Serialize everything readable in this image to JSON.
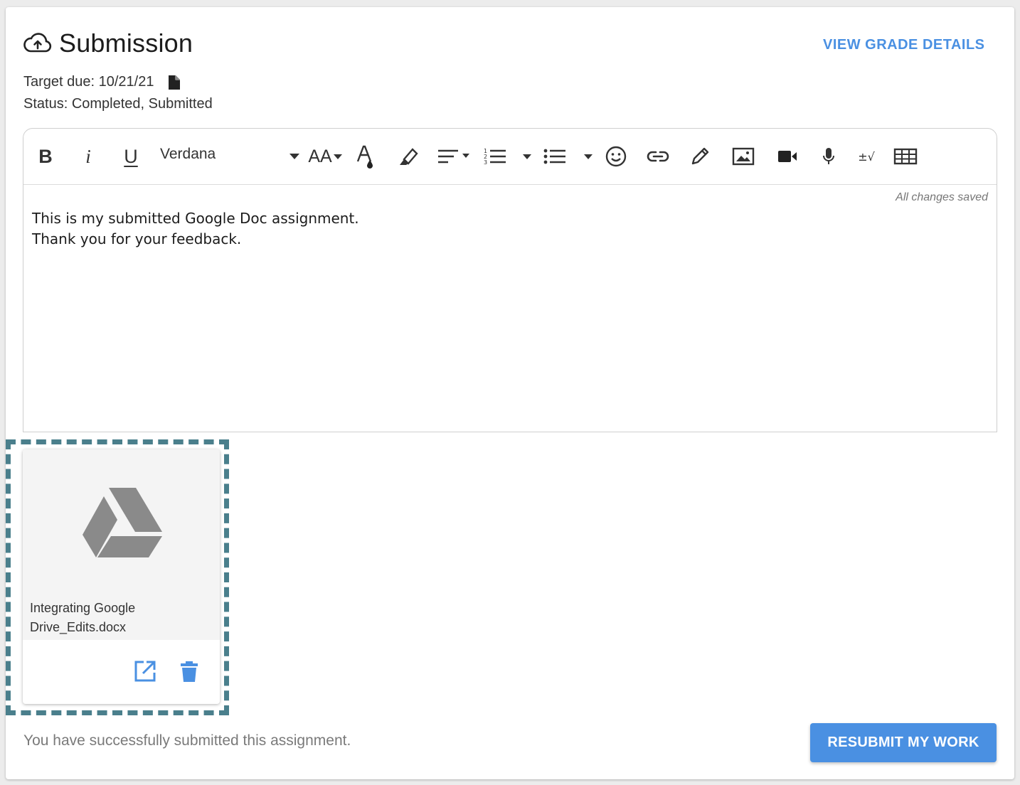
{
  "header": {
    "title": "Submission",
    "title_icon": "cloud-upload-icon",
    "grade_link": "VIEW GRADE DETAILS"
  },
  "meta": {
    "due": "Target due: 10/21/21",
    "due_icon": "document-icon",
    "status": "Status: Completed, Submitted"
  },
  "toolbar": {
    "bold": "B",
    "italic": "i",
    "underline": "U",
    "font": "Verdana",
    "font_size": "AA",
    "formula": "±√",
    "icons": [
      "bold-icon",
      "italic-icon",
      "underline-icon",
      "font-dropdown",
      "font-size-icon",
      "text-color-icon",
      "highlight-icon",
      "align-icon",
      "numbered-list-icon",
      "bulleted-list-icon",
      "emoji-icon",
      "link-icon",
      "pencil-icon",
      "image-icon",
      "video-icon",
      "microphone-icon",
      "math-icon",
      "table-icon"
    ]
  },
  "editor": {
    "saved_status": "All changes saved",
    "lines": [
      "This is my submitted Google Doc assignment.",
      "Thank you for your feedback."
    ]
  },
  "attachment": {
    "icon": "google-drive-icon",
    "file_name": "Integrating Google Drive_Edits.docx"
  },
  "footer": {
    "message": "You have successfully submitted this assignment.",
    "resubmit_label": "RESUBMIT MY WORK"
  },
  "colors": {
    "accent": "#4a90e2",
    "dash_frame": "#4a7f8c",
    "drive_icon": "#8a8a8a"
  }
}
